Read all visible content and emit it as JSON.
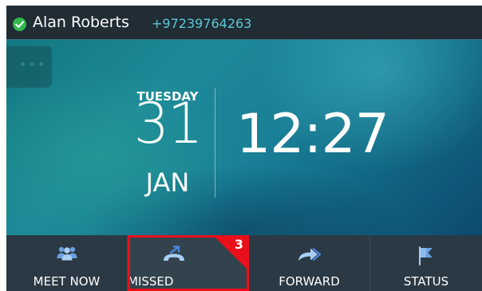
{
  "header": {
    "presence": "available",
    "user_name": "Alan Roberts",
    "user_number": "+97239764263",
    "presence_color": "#30b84c"
  },
  "home": {
    "more_icon": "ellipsis-icon",
    "day": "TUESDAY",
    "date": "31",
    "month": "JAN",
    "time": "12:27"
  },
  "softkeys": [
    {
      "label": "MEET NOW",
      "icon": "people-icon"
    },
    {
      "label": "MISSED",
      "icon": "missed-call-icon",
      "badge": "3"
    },
    {
      "label": "FORWARD",
      "icon": "forward-arrow-icon"
    },
    {
      "label": "STATUS",
      "icon": "flag-icon"
    }
  ],
  "colors": {
    "accent": "#5fc7d6",
    "badge": "#e8101b",
    "bar": "#2b3944"
  }
}
